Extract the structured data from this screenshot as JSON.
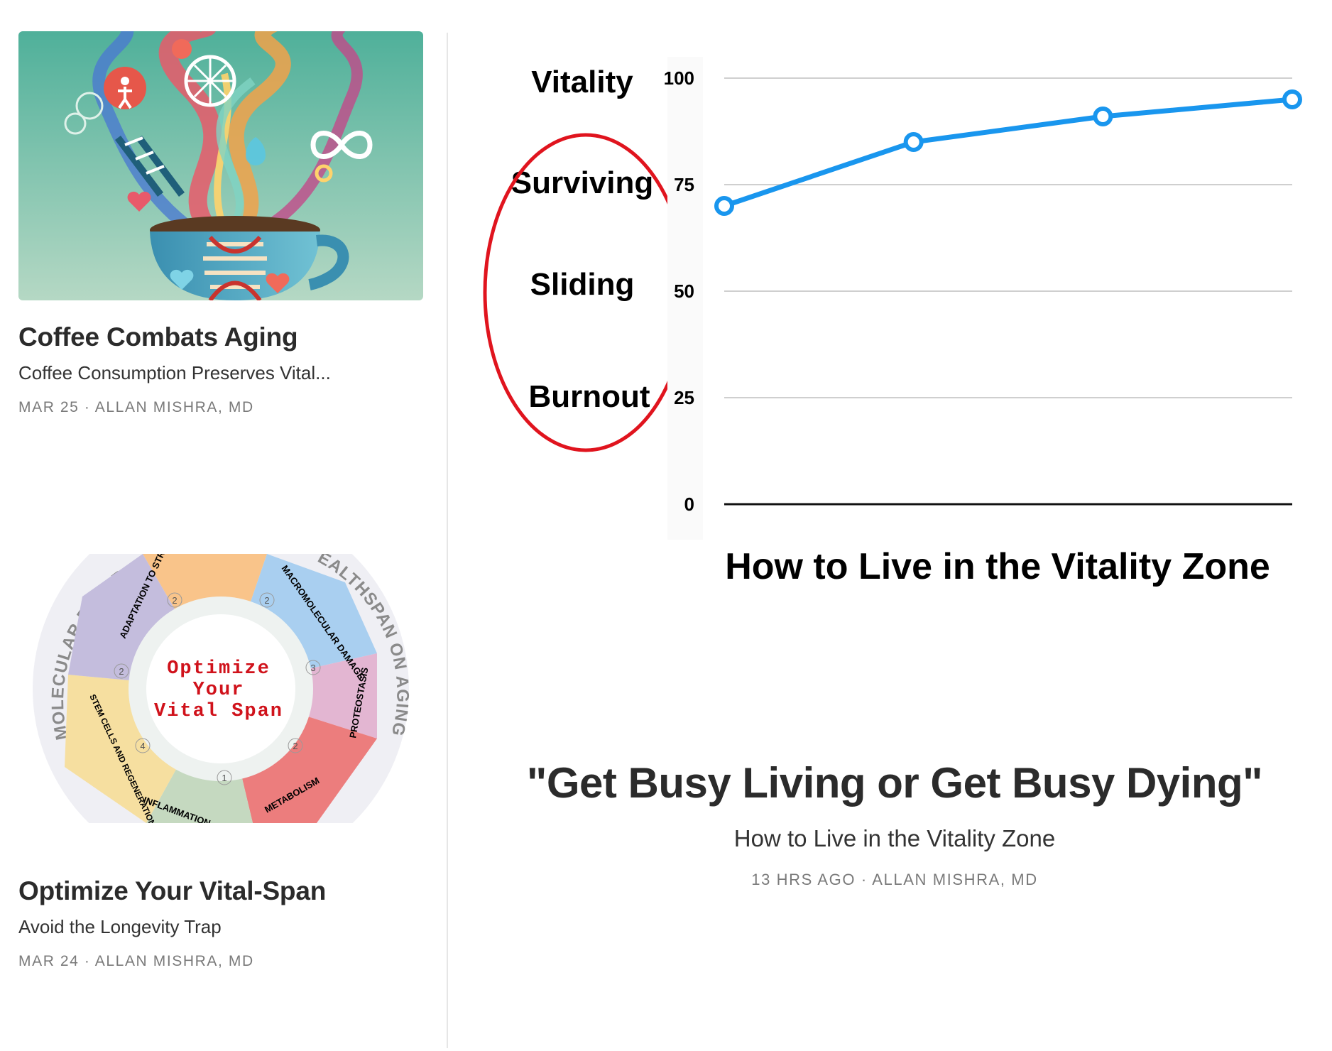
{
  "posts": [
    {
      "title": "Coffee Combats Aging",
      "subtitle": "Coffee Consumption Preserves Vital...",
      "date": "MAR 25",
      "separator": "·",
      "author": "ALLAN MISHRA, MD",
      "image_icon": "coffee-cup-illustration"
    },
    {
      "title": "Optimize Your Vital-Span",
      "subtitle": "Avoid the Longevity Trap",
      "date": "MAR 24",
      "separator": "·",
      "author": "ALLAN MISHRA, MD",
      "image_icon": "vital-span-wheel-illustration",
      "image_text": {
        "center": [
          "Optimize",
          "Your",
          "Vital Span"
        ],
        "outer_ring": [
          "MOLECULAR DETERMI",
          "EALTHSPAN ON AGING"
        ],
        "segments": [
          "ADAPTATION TO STRESS",
          "MACROMOLECULAR DAMAGE",
          "PROTEOSTASIS",
          "METABOLISM",
          "INFLAMMATION",
          "STEM CELLS AND REGENERATION"
        ],
        "segment_numbers": [
          "2",
          "2",
          "2",
          "3",
          "2",
          "1",
          "4"
        ]
      }
    }
  ],
  "featured": {
    "title": "\"Get Busy Living or Get Busy Dying\"",
    "subtitle": "How to Live in the Vitality Zone",
    "time": "13 HRS AGO",
    "separator": "·",
    "author": "ALLAN MISHRA, MD",
    "image": {
      "zone_labels": [
        "Vitality",
        "Surviving",
        "Sliding",
        "Burnout"
      ],
      "caption": "How to Live in the Vitality Zone",
      "highlight_color": "#e0141e",
      "line_color": "#1996ee"
    }
  },
  "chart_data": {
    "type": "line",
    "title": "How to Live in the Vitality Zone",
    "xlabel": "",
    "ylabel": "",
    "ylim": [
      0,
      100
    ],
    "yticks": [
      0,
      25,
      50,
      75,
      100
    ],
    "grid": true,
    "series": [
      {
        "values": [
          70,
          85,
          91,
          95
        ]
      }
    ]
  }
}
